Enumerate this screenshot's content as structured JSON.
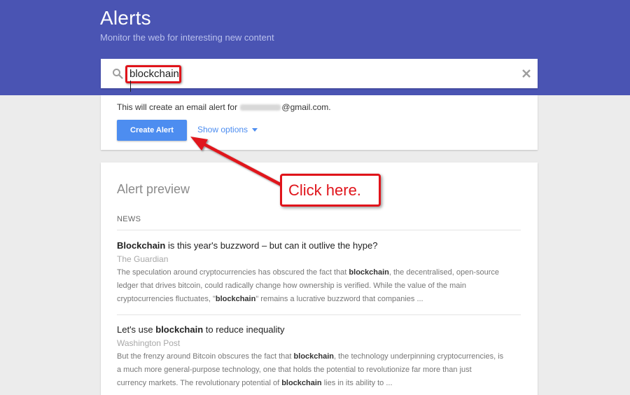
{
  "header": {
    "title": "Alerts",
    "subtitle": "Monitor the web for interesting new content"
  },
  "search": {
    "value": "blockchain",
    "search_icon": "search-icon",
    "clear_icon": "close-icon"
  },
  "create": {
    "email_prefix": "This will create an email alert for",
    "email_suffix": "@gmail.com.",
    "button_label": "Create Alert",
    "options_label": "Show options"
  },
  "preview": {
    "title": "Alert preview",
    "section": "NEWS",
    "articles": [
      {
        "title_bold": "Blockchain",
        "title_rest": " is this year's buzzword – but can it outlive the hype?",
        "source": "The Guardian",
        "snippet": [
          "The speculation around cryptocurrencies has obscured the fact that ",
          "blockchain",
          ", the decentralised, open-source",
          "ledger that drives bitcoin, could radically change how ownership is verified. While the value of the main",
          "cryptocurrencies fluctuates, \"",
          "blockchain",
          "\" remains a lucrative buzzword that companies ..."
        ]
      },
      {
        "title_pre": "Let's use ",
        "title_bold": "blockchain",
        "title_rest": " to reduce inequality",
        "source": "Washington Post",
        "snippet": [
          "But the frenzy around Bitcoin obscures the fact that ",
          "blockchain",
          ", the technology underpinning cryptocurrencies, is",
          "a much more general-purpose technology, one that holds the potential to revolutionize far more than just",
          "currency markets. The revolutionary potential of ",
          "blockchain",
          " lies in its ability to ..."
        ]
      }
    ]
  },
  "annotation": {
    "callout_text": "Click here.",
    "color": "#e0141b"
  },
  "colors": {
    "header_bg": "#4a54b3",
    "button_blue": "#4d8df0",
    "page_bg": "#ececec"
  }
}
